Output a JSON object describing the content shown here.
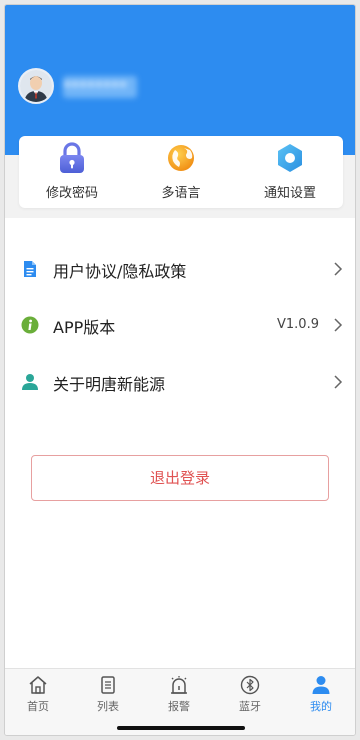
{
  "colors": {
    "brand_blue": "#2d8cf0",
    "logout_red": "#e05252",
    "doc_icon_blue": "#2d8cf0",
    "info_icon_green": "#6aae3a",
    "person_icon_teal": "#2aa698"
  },
  "profile": {
    "avatar_icon": "user-avatar",
    "name": "********"
  },
  "quick_actions": [
    {
      "label": "修改密码",
      "icon": "lock-icon"
    },
    {
      "label": "多语言",
      "icon": "globe-icon"
    },
    {
      "label": "通知设置",
      "icon": "hexagon-settings-icon"
    }
  ],
  "menu": [
    {
      "label": "用户协议/隐私政策",
      "value": "",
      "icon": "document-icon"
    },
    {
      "label": "APP版本",
      "value": "V1.0.9",
      "icon": "info-icon"
    },
    {
      "label": "关于明唐新能源",
      "value": "",
      "icon": "person-icon"
    }
  ],
  "logout_label": "退出登录",
  "tabs": [
    {
      "label": "首页",
      "icon": "home-icon",
      "active": false
    },
    {
      "label": "列表",
      "icon": "list-icon",
      "active": false
    },
    {
      "label": "报警",
      "icon": "alarm-icon",
      "active": false
    },
    {
      "label": "蓝牙",
      "icon": "bluetooth-icon",
      "active": false
    },
    {
      "label": "我的",
      "icon": "user-icon",
      "active": true
    }
  ]
}
